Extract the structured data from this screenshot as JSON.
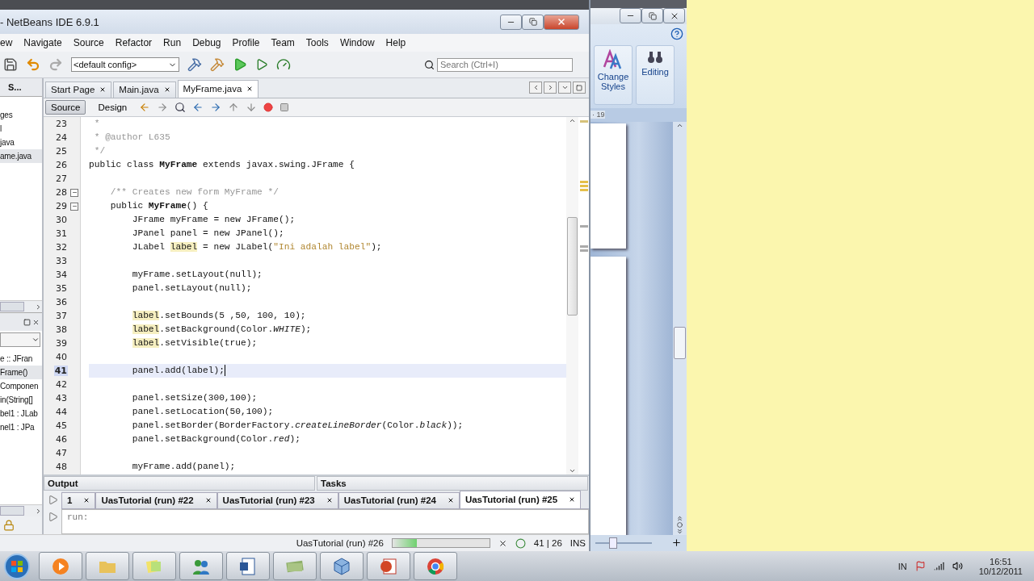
{
  "netbeans": {
    "title": "- NetBeans IDE 6.9.1",
    "menu": [
      "ew",
      "Navigate",
      "Source",
      "Refactor",
      "Run",
      "Debug",
      "Profile",
      "Team",
      "Tools",
      "Window",
      "Help"
    ],
    "config": "<default config>",
    "search": {
      "placeholder": "Search (Ctrl+I)"
    },
    "projects_tab": "S...",
    "project_items": [
      {
        "label": "ges",
        "selected": false
      },
      {
        "label": "l",
        "selected": false
      },
      {
        "label": "java",
        "selected": false
      },
      {
        "label": "ame.java",
        "selected": true
      }
    ],
    "navigator_items": [
      {
        "label": "e :: JFran",
        "selected": false
      },
      {
        "label": "Frame()",
        "selected": true
      },
      {
        "label": "Componen",
        "selected": false
      },
      {
        "label": "in(String[]",
        "selected": false
      },
      {
        "label": "bel1 : JLab",
        "selected": false
      },
      {
        "label": "nel1 : JPa",
        "selected": false
      }
    ],
    "editor_tabs": [
      {
        "label": "Start Page",
        "selected": false
      },
      {
        "label": "Main.java",
        "selected": false
      },
      {
        "label": "MyFrame.java",
        "selected": true
      }
    ],
    "view_toggle": [
      {
        "label": "Source",
        "selected": true
      },
      {
        "label": "Design",
        "selected": false
      }
    ],
    "code_lines": [
      {
        "number": "23",
        "current": false,
        "fold": false,
        "segments": [
          {
            "text": " *",
            "kind": "comment"
          }
        ]
      },
      {
        "number": "24",
        "current": false,
        "fold": false,
        "segments": [
          {
            "text": " * @author L635",
            "kind": "comment"
          }
        ]
      },
      {
        "number": "25",
        "current": false,
        "fold": false,
        "segments": [
          {
            "text": " */",
            "kind": "comment"
          }
        ]
      },
      {
        "number": "26",
        "current": false,
        "fold": false,
        "segments": [
          {
            "text": "public class ",
            "kind": "plain"
          },
          {
            "text": "MyFrame",
            "kind": "bold"
          },
          {
            "text": " extends javax.swing.JFrame {",
            "kind": "plain"
          }
        ]
      },
      {
        "number": "27",
        "current": false,
        "fold": false
      },
      {
        "number": "28",
        "current": false,
        "fold": true,
        "segments": [
          {
            "text": "    /** Creates new form MyFrame */",
            "kind": "comment"
          }
        ]
      },
      {
        "number": "29",
        "current": false,
        "fold": true,
        "segments": [
          {
            "text": "    public ",
            "kind": "plain"
          },
          {
            "text": "MyFrame",
            "kind": "bold"
          },
          {
            "text": "() {",
            "kind": "plain"
          }
        ]
      },
      {
        "number": "30",
        "current": false,
        "fold": false,
        "segments": [
          {
            "text": "        JFrame myFrame = new JFrame();",
            "kind": "plain"
          }
        ]
      },
      {
        "number": "31",
        "current": false,
        "fold": false,
        "segments": [
          {
            "text": "        JPanel panel = new JPanel();",
            "kind": "plain"
          }
        ]
      },
      {
        "number": "32",
        "current": false,
        "fold": false,
        "segments": [
          {
            "text": "        JLabel ",
            "kind": "plain"
          },
          {
            "text": "label",
            "kind": "highlight"
          },
          {
            "text": " = new JLabel(",
            "kind": "plain"
          },
          {
            "text": "\"Ini adalah label\"",
            "kind": "string"
          },
          {
            "text": ");",
            "kind": "plain"
          }
        ]
      },
      {
        "number": "33",
        "current": false,
        "fold": false
      },
      {
        "number": "34",
        "current": false,
        "fold": false,
        "segments": [
          {
            "text": "        myFrame.setLayout(null);",
            "kind": "plain"
          }
        ]
      },
      {
        "number": "35",
        "current": false,
        "fold": false,
        "segments": [
          {
            "text": "        panel.setLayout(null);",
            "kind": "plain"
          }
        ]
      },
      {
        "number": "36",
        "current": false,
        "fold": false
      },
      {
        "number": "37",
        "current": false,
        "fold": false,
        "segments": [
          {
            "text": "        label",
            "kind": "highlight"
          },
          {
            "text": ".setBounds(5 ,50, 100, 10);",
            "kind": "plain"
          }
        ]
      },
      {
        "number": "38",
        "current": false,
        "fold": false,
        "segments": [
          {
            "text": "        label",
            "kind": "highlight"
          },
          {
            "text": ".setBackground(Color.",
            "kind": "plain"
          },
          {
            "text": "WHITE",
            "kind": "italic"
          },
          {
            "text": ");",
            "kind": "plain"
          }
        ]
      },
      {
        "number": "39",
        "current": false,
        "fold": false,
        "segments": [
          {
            "text": "        label",
            "kind": "highlight"
          },
          {
            "text": ".setVisible(true);",
            "kind": "plain"
          }
        ]
      },
      {
        "number": "40",
        "current": false,
        "fold": false
      },
      {
        "number": "41",
        "current": true,
        "fold": false,
        "segments": [
          {
            "text": "        panel.add(label);",
            "kind": "plain"
          }
        ]
      },
      {
        "number": "42",
        "current": false,
        "fold": false
      },
      {
        "number": "43",
        "current": false,
        "fold": false,
        "segments": [
          {
            "text": "        panel.setSize(300,100);",
            "kind": "plain"
          }
        ]
      },
      {
        "number": "44",
        "current": false,
        "fold": false,
        "segments": [
          {
            "text": "        panel.setLocation(50,100);",
            "kind": "plain"
          }
        ]
      },
      {
        "number": "45",
        "current": false,
        "fold": false,
        "segments": [
          {
            "text": "        panel.setBorder(BorderFactory.",
            "kind": "plain"
          },
          {
            "text": "createLineBorder",
            "kind": "italic"
          },
          {
            "text": "(Color.",
            "kind": "plain"
          },
          {
            "text": "black",
            "kind": "italic"
          },
          {
            "text": "));",
            "kind": "plain"
          }
        ]
      },
      {
        "number": "46",
        "current": false,
        "fold": false,
        "segments": [
          {
            "text": "        panel.setBackground(Color.",
            "kind": "plain"
          },
          {
            "text": "red",
            "kind": "italic"
          },
          {
            "text": ");",
            "kind": "plain"
          }
        ]
      },
      {
        "number": "47",
        "current": false,
        "fold": false
      },
      {
        "number": "48",
        "current": false,
        "fold": false,
        "segments": [
          {
            "text": "        myFrame.add(panel);",
            "kind": "plain"
          }
        ]
      }
    ],
    "output": {
      "title": "Output",
      "tasks_title": "Tasks",
      "tabs": [
        {
          "label": "1",
          "selected": false
        },
        {
          "label": "UasTutorial (run) #22",
          "selected": false
        },
        {
          "label": "UasTutorial (run) #23",
          "selected": false
        },
        {
          "label": "UasTutorial (run) #24",
          "selected": false
        },
        {
          "label": "UasTutorial (run) #25",
          "selected": true
        }
      ],
      "text": "run:"
    },
    "status": {
      "task": "UasTutorial (run) #26",
      "level": 0.25,
      "position": "41 | 26",
      "mode": "INS"
    }
  },
  "word": {
    "ribbon": [
      {
        "label": "Change Styles",
        "kind": "styles"
      },
      {
        "label": "Editing",
        "kind": "editing"
      }
    ],
    "ruler": "· 19",
    "zoom": {
      "level": 0.3
    }
  },
  "taskbar": {
    "language": "IN",
    "time": "16:51",
    "date": "10/12/2011"
  }
}
